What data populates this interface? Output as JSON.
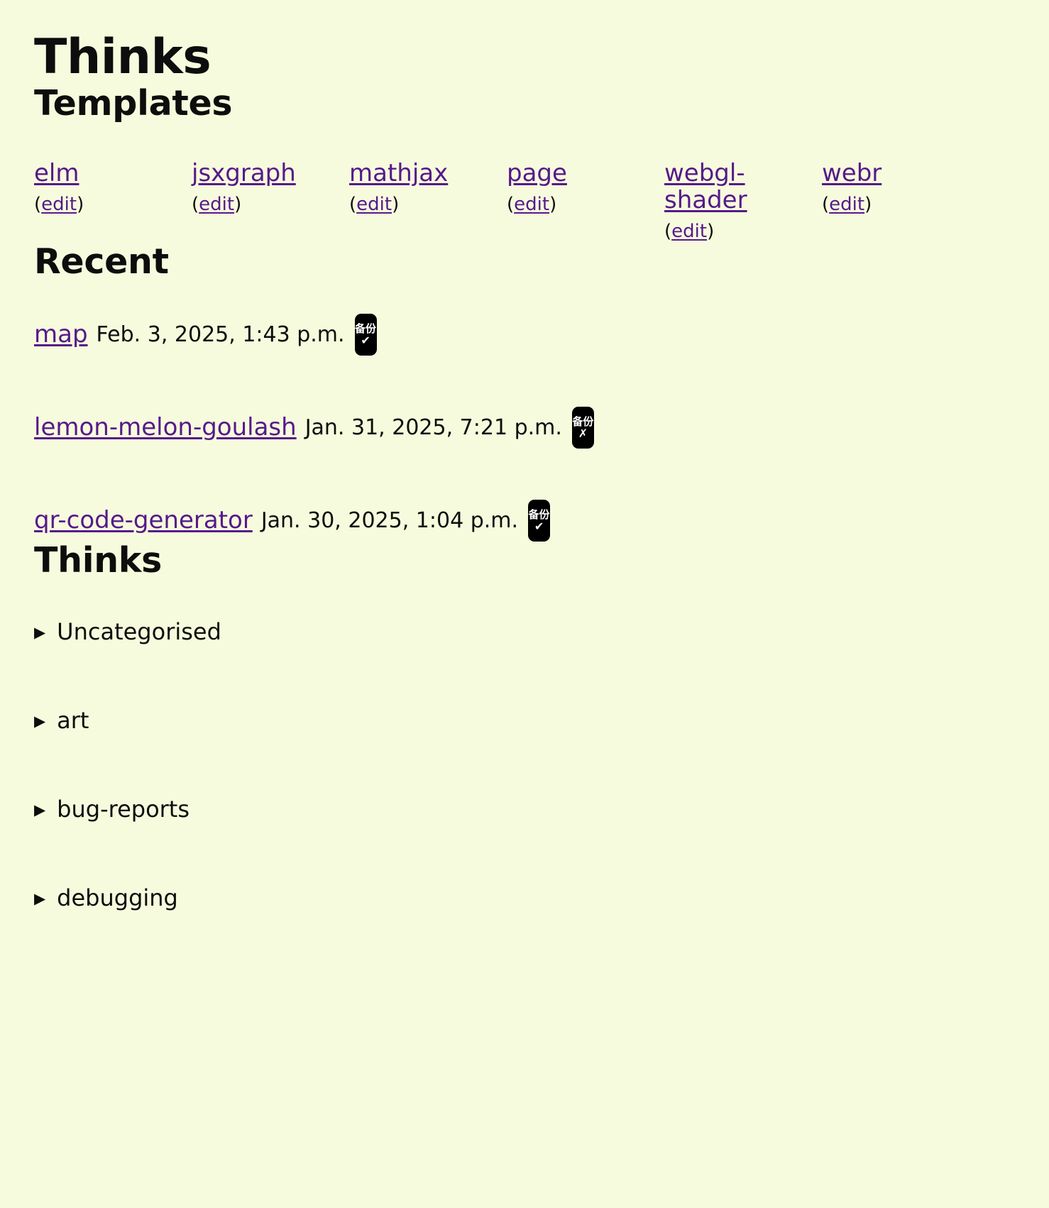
{
  "site": {
    "title": "Thinks",
    "background_color": "#f7fbdd",
    "link_color": "#551a8b",
    "text_color": "#0d0d0d"
  },
  "templates": {
    "heading": "Templates",
    "edit_label": "edit",
    "paren_open": "(",
    "paren_close": ")",
    "items": [
      {
        "name": "elm"
      },
      {
        "name": "jsxgraph"
      },
      {
        "name": "mathjax"
      },
      {
        "name": "page"
      },
      {
        "name": "webgl-shader"
      },
      {
        "name": "webr"
      }
    ]
  },
  "recent": {
    "heading": "Recent",
    "items": [
      {
        "name": "map",
        "date": "Feb. 3, 2025, 1:43 p.m.",
        "badge": {
          "icon": "backup-badge-icon",
          "text": "备份",
          "mark": "✔",
          "status": "backed-up"
        }
      },
      {
        "name": "lemon-melon-goulash",
        "date": "Jan. 31, 2025, 7:21 p.m.",
        "badge": {
          "icon": "backup-badge-icon",
          "text": "备份",
          "mark": "✗",
          "status": "not-backed-up"
        }
      },
      {
        "name": "qr-code-generator",
        "date": "Jan. 30, 2025, 1:04 p.m.",
        "badge": {
          "icon": "backup-badge-icon",
          "text": "备份",
          "mark": "✔",
          "status": "backed-up"
        }
      }
    ]
  },
  "thinks": {
    "heading": "Thinks",
    "marker": "▶",
    "categories": [
      {
        "label": "Uncategorised"
      },
      {
        "label": "art"
      },
      {
        "label": "bug-reports"
      },
      {
        "label": "debugging"
      }
    ]
  }
}
